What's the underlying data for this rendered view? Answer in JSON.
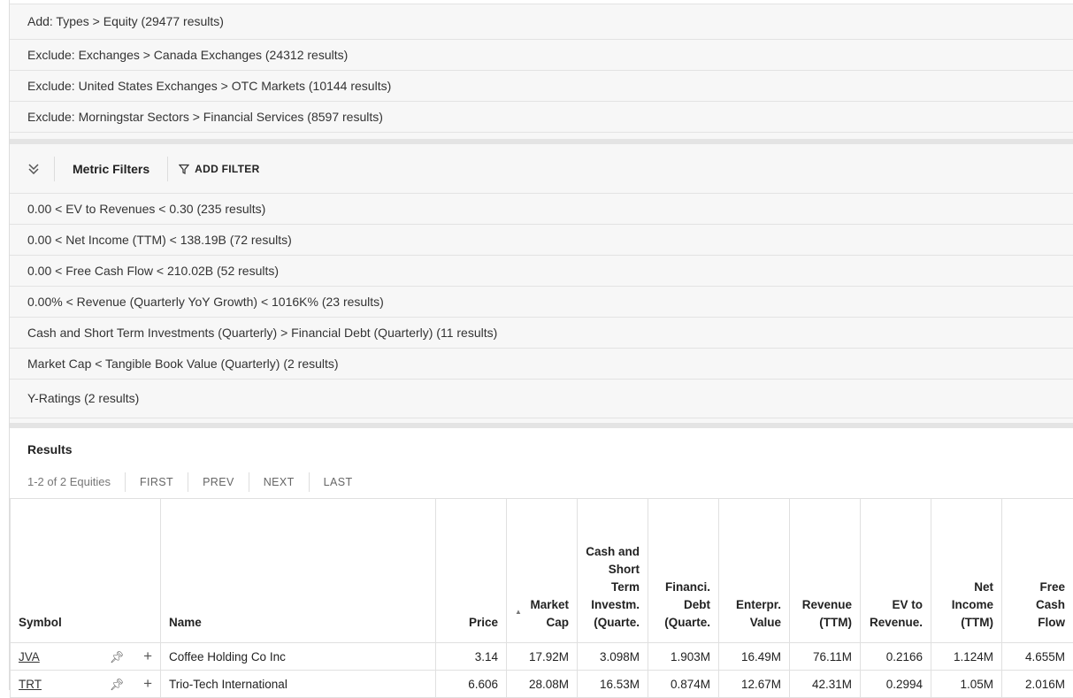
{
  "type_filters": [
    "Add: Types > Equity (29477 results)",
    "Exclude: Exchanges > Canada Exchanges (24312 results)",
    "Exclude: United States Exchanges > OTC Markets (10144 results)",
    "Exclude: Morningstar Sectors > Financial Services (8597 results)"
  ],
  "metric_filters": {
    "title": "Metric Filters",
    "add_filter_label": "ADD FILTER",
    "items": [
      "0.00 < EV to Revenues < 0.30 (235 results)",
      "0.00 < Net Income (TTM) < 138.19B (72 results)",
      "0.00 < Free Cash Flow < 210.02B (52 results)",
      "0.00% < Revenue (Quarterly YoY Growth) < 1016K% (23 results)",
      "Cash and Short Term Investments (Quarterly) > Financial Debt (Quarterly) (11 results)",
      "Market Cap < Tangible Book Value (Quarterly) (2 results)",
      "Y-Ratings (2 results)"
    ]
  },
  "results": {
    "title": "Results",
    "count_text": "1-2 of 2 Equities",
    "pager": [
      "FIRST",
      "PREV",
      "NEXT",
      "LAST"
    ],
    "headers": {
      "symbol": "Symbol",
      "name": "Name",
      "price": "Price",
      "sort_indicator": "▲",
      "market_cap": [
        "Market",
        "Cap"
      ],
      "cash": [
        "Cash and",
        "Short",
        "Term",
        "Investm.",
        "(Quarte."
      ],
      "debt": [
        "Financi.",
        "Debt",
        "(Quarte."
      ],
      "ev": [
        "Enterpr.",
        "Value"
      ],
      "revenue": [
        "Revenue",
        "(TTM)"
      ],
      "ev_rev": [
        "EV to",
        "Revenue."
      ],
      "net_income": [
        "Net",
        "Income",
        "(TTM)"
      ],
      "fcf": [
        "Free",
        "Cash",
        "Flow"
      ]
    },
    "row_icons": {
      "pin": "pin-icon",
      "add": "plus-icon"
    },
    "rows": [
      {
        "symbol": "JVA",
        "name": "Coffee Holding Co Inc",
        "price": "3.14",
        "market_cap": "17.92M",
        "cash": "3.098M",
        "debt": "1.903M",
        "ev": "16.49M",
        "revenue": "76.11M",
        "ev_rev": "0.2166",
        "net_income": "1.124M",
        "fcf": "4.655M"
      },
      {
        "symbol": "TRT",
        "name": "Trio-Tech International",
        "price": "6.606",
        "market_cap": "28.08M",
        "cash": "16.53M",
        "debt": "0.874M",
        "ev": "12.67M",
        "revenue": "42.31M",
        "ev_rev": "0.2994",
        "net_income": "1.05M",
        "fcf": "2.016M"
      }
    ]
  }
}
